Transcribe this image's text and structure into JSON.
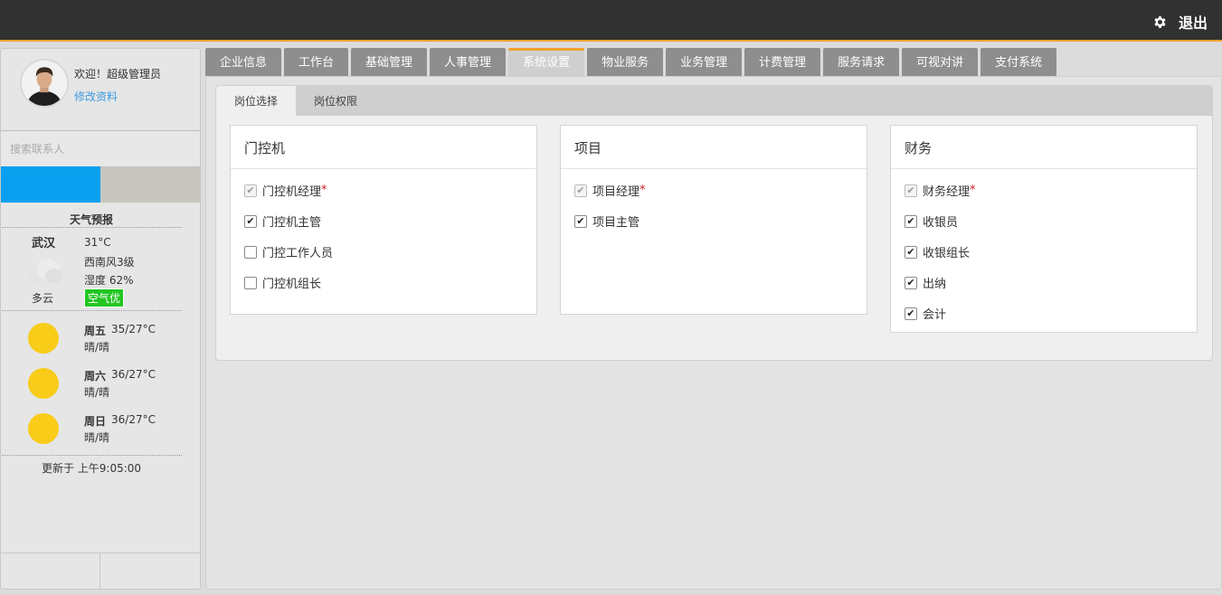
{
  "topbar": {
    "logout_label": "退出"
  },
  "sidebar": {
    "welcome": "欢迎！超级管理员",
    "edit_profile": "修改资料",
    "search_placeholder": "搜索联系人"
  },
  "weather": {
    "title": "天气预报",
    "city": "武汉",
    "temperature": "31°C",
    "wind": "西南风3级",
    "humidity": "湿度 62%",
    "condition": "多云",
    "air_quality": "空气优",
    "forecast": [
      {
        "day": "周五",
        "temp": "35/27°C",
        "desc": "晴/晴"
      },
      {
        "day": "周六",
        "temp": "36/27°C",
        "desc": "晴/晴"
      },
      {
        "day": "周日",
        "temp": "36/27°C",
        "desc": "晴/晴"
      }
    ],
    "updated": "更新于 上午9:05:00"
  },
  "main_tabs": [
    "企业信息",
    "工作台",
    "基础管理",
    "人事管理",
    "系统设置",
    "物业服务",
    "业务管理",
    "计费管理",
    "服务请求",
    "可视对讲",
    "支付系统"
  ],
  "active_main_tab": "系统设置",
  "sub_tabs": [
    "岗位选择",
    "岗位权限"
  ],
  "cards": [
    {
      "title": "门控机",
      "items": [
        {
          "label": "门控机经理",
          "state": "disabled",
          "required": "*"
        },
        {
          "label": "门控机主管",
          "state": "checked"
        },
        {
          "label": "门控工作人员",
          "state": "unchecked"
        },
        {
          "label": "门控机组长",
          "state": "unchecked"
        }
      ]
    },
    {
      "title": "项目",
      "items": [
        {
          "label": "项目经理",
          "state": "disabled",
          "required": "*"
        },
        {
          "label": "项目主管",
          "state": "checked"
        }
      ]
    },
    {
      "title": "财务",
      "items": [
        {
          "label": "财务经理",
          "state": "disabled",
          "required": "*"
        },
        {
          "label": "收银员",
          "state": "checked"
        },
        {
          "label": "收银组长",
          "state": "checked"
        },
        {
          "label": "出纳",
          "state": "checked"
        },
        {
          "label": "会计",
          "state": "checked"
        }
      ]
    }
  ]
}
